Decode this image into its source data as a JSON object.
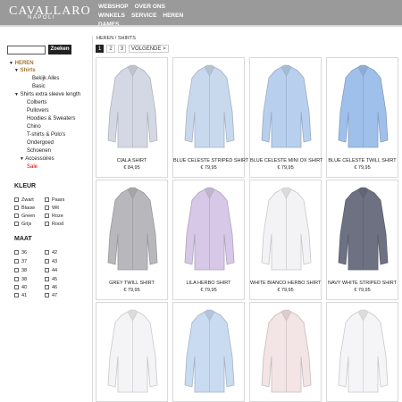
{
  "header": {
    "logo": "CAVALLARO",
    "logo_sub": "NAPOLI",
    "nav": [
      "WEBSHOP",
      "OVER ONS",
      "WINKELS",
      "SERVICE",
      "HEREN",
      "DAMES"
    ],
    "bg_color": "#9a9a9a"
  },
  "search": {
    "placeholder": "",
    "button": "Zoeken"
  },
  "categories": {
    "heren": "HEREN",
    "shirts": "Shirts",
    "bekijk_alles": "Bekijk Alles",
    "basic": "Basic",
    "shirts_extra": "Shirts extra sleeve length",
    "colberts": "Colberts",
    "pullovers": "Pullovers",
    "hoodies": "Hoodies & Sweaters",
    "chino": "Chino",
    "tshirts": "T-shirts & Polo's",
    "ondergoed": "Ondergoed",
    "schoenen": "Schoenen",
    "accessoires": "Accessoires",
    "sale": "Sale"
  },
  "kleur": {
    "title": "KLEUR",
    "options": [
      "Zwart",
      "Paars",
      "Blauw",
      "Wit",
      "Green",
      "Roze",
      "Grijs",
      "Rood"
    ]
  },
  "maat": {
    "title": "MAAT",
    "options": [
      "36",
      "42",
      "37",
      "43",
      "38",
      "44",
      "38",
      "45",
      "40",
      "46",
      "41",
      "47"
    ]
  },
  "breadcrumb": "HEREN / SHIRTS",
  "pagination": {
    "pages": [
      "1",
      "2",
      "3"
    ],
    "next": "VOLGENDE >"
  },
  "products": [
    {
      "name": "CIALA SHIRT",
      "price": "€ 84,95",
      "color": "#d4d8e4"
    },
    {
      "name": "BLUE CELESTE STRIPED SHIRT",
      "price": "€ 79,95",
      "color": "#c8d9ee"
    },
    {
      "name": "BLUE CELESTE MINI OX SHIRT",
      "price": "€ 79,95",
      "color": "#b8d0ee"
    },
    {
      "name": "BLUE CELESTE TWILL SHIRT",
      "price": "€ 79,95",
      "color": "#9fc0ea"
    },
    {
      "name": "GREY TWILL SHIRT",
      "price": "€ 79,95",
      "color": "#b8b8bc"
    },
    {
      "name": "LILA HERBO SHIRT",
      "price": "€ 79,95",
      "color": "#d6c8e6"
    },
    {
      "name": "WHITE BIANCO HERBO SHIRT",
      "price": "€ 79,95",
      "color": "#f3f3f5"
    },
    {
      "name": "NAVY WHITE STRIPED SHIRT",
      "price": "€ 79,95",
      "color": "#6e7182"
    },
    {
      "name": "",
      "price": "",
      "color": "#f4f4f6"
    },
    {
      "name": "",
      "price": "",
      "color": "#c9dbf1"
    },
    {
      "name": "",
      "price": "",
      "color": "#f3e4e6"
    },
    {
      "name": "",
      "price": "",
      "color": "#f5f5f7"
    }
  ]
}
